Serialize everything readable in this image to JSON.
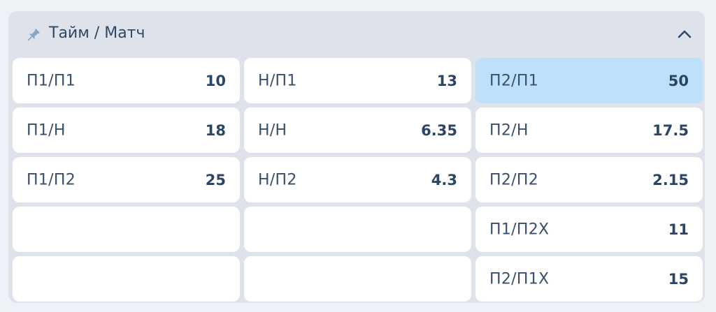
{
  "market": {
    "title": "Тайм / Матч",
    "pin_icon": "pin-icon",
    "collapse_icon": "chevron-up-icon"
  },
  "colors": {
    "card_bg": "#dde2eb",
    "cell_bg": "#ffffff",
    "selected_bg": "#bfe0fb",
    "text": "#3a4f6b"
  },
  "outcomes": [
    {
      "label": "П1/П1",
      "odd": "10"
    },
    {
      "label": "Н/П1",
      "odd": "13"
    },
    {
      "label": "П2/П1",
      "odd": "50",
      "selected": true
    },
    {
      "label": "П1/Н",
      "odd": "18"
    },
    {
      "label": "Н/Н",
      "odd": "6.35"
    },
    {
      "label": "П2/Н",
      "odd": "17.5"
    },
    {
      "label": "П1/П2",
      "odd": "25"
    },
    {
      "label": "Н/П2",
      "odd": "4.3"
    },
    {
      "label": "П2/П2",
      "odd": "2.15"
    },
    {
      "label": "",
      "odd": ""
    },
    {
      "label": "",
      "odd": ""
    },
    {
      "label": "П1/П2Х",
      "odd": "11"
    },
    {
      "label": "",
      "odd": ""
    },
    {
      "label": "",
      "odd": ""
    },
    {
      "label": "П2/П1Х",
      "odd": "15"
    }
  ]
}
